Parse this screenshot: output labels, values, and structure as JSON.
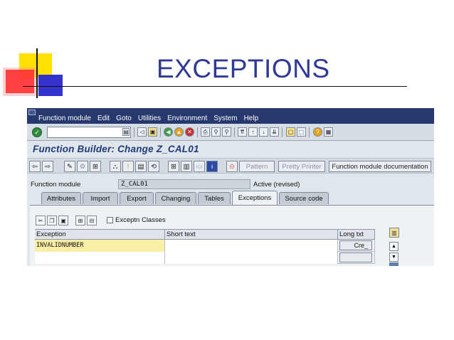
{
  "slide": {
    "title": "EXCEPTIONS"
  },
  "menubar": {
    "items": [
      "Function module",
      "Edit",
      "Goto",
      "Utilities",
      "Environment",
      "System",
      "Help"
    ]
  },
  "toolbar": {
    "command_value": ""
  },
  "screen": {
    "title": "Function Builder: Change Z_CAL01"
  },
  "app_toolbar": {
    "pattern_label": "Pattern",
    "pretty_printer_label": "Pretty Printer",
    "documentation_label": "Function module documentation"
  },
  "function_module": {
    "label": "Function module",
    "value": "Z_CAL01",
    "status": "Active (revised)"
  },
  "tabs": [
    {
      "label": "Attributes",
      "active": false
    },
    {
      "label": "Import",
      "active": false
    },
    {
      "label": "Export",
      "active": false
    },
    {
      "label": "Changing",
      "active": false
    },
    {
      "label": "Tables",
      "active": false
    },
    {
      "label": "Exceptions",
      "active": true
    },
    {
      "label": "Source code",
      "active": false
    }
  ],
  "exceptions_panel": {
    "classes_checkbox_label": "Exceptn Classes",
    "columns": [
      "Exception",
      "Short text",
      "Long txt"
    ],
    "rows": [
      {
        "exception": "INVALIDNUMBER",
        "short_text": "",
        "long_text_button": "Cre_"
      },
      {
        "exception": "",
        "short_text": "",
        "long_text_button": ""
      }
    ]
  },
  "colors": {
    "menubar_bg": "#26386e",
    "title_text": "#2e3a96",
    "exception_cell": "#fbefa5"
  }
}
